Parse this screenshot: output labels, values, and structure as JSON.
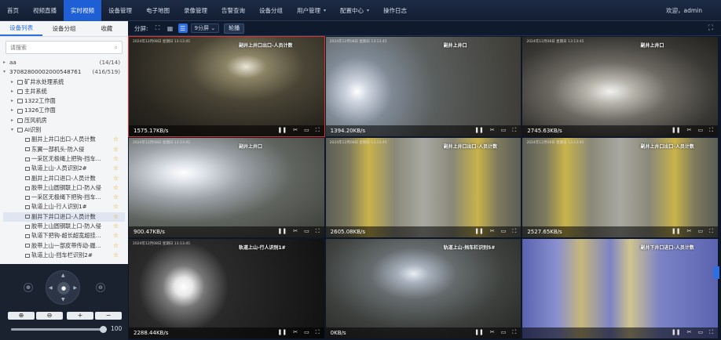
{
  "nav": {
    "items": [
      {
        "label": "首页"
      },
      {
        "label": "视频直播"
      },
      {
        "label": "实时视频",
        "active": true
      },
      {
        "label": "设备管理"
      },
      {
        "label": "电子地图"
      },
      {
        "label": "录像管理"
      },
      {
        "label": "告警查询"
      },
      {
        "label": "设备分组"
      },
      {
        "label": "用户管理",
        "dropdown": true
      },
      {
        "label": "配置中心",
        "dropdown": true
      },
      {
        "label": "操作日志"
      }
    ],
    "welcome": "欢迎，admin",
    "accent": "#1f5fd6"
  },
  "sidebar": {
    "tabs": [
      {
        "label": "设备列表",
        "active": true
      },
      {
        "label": "设备分组"
      },
      {
        "label": "收藏"
      }
    ],
    "search_placeholder": "请搜索",
    "tree": [
      {
        "label": "aa",
        "count": "(14/14)",
        "level": 0,
        "type": "arrow"
      },
      {
        "label": "37082800002000548761",
        "count": "(416/519)",
        "level": 0,
        "type": "arrow-open"
      },
      {
        "label": "矿井水处理系统",
        "level": 1,
        "type": "folder"
      },
      {
        "label": "主井系统",
        "level": 1,
        "type": "folder"
      },
      {
        "label": "1322工作面",
        "level": 1,
        "type": "folder"
      },
      {
        "label": "1326工作面",
        "level": 1,
        "type": "folder"
      },
      {
        "label": "压风机房",
        "level": 1,
        "type": "folder"
      },
      {
        "label": "AI识别",
        "level": 1,
        "type": "folder-open"
      },
      {
        "label": "副井上井口出口-人员计数",
        "level": 2,
        "type": "cam",
        "star": true
      },
      {
        "label": "东翼一部机头-防入侵",
        "level": 2,
        "type": "cam",
        "star": true
      },
      {
        "label": "一采区无极绳上把钩-挡车...",
        "level": 2,
        "type": "cam",
        "star": true
      },
      {
        "label": "轨道上山-人员识别2#",
        "level": 2,
        "type": "cam",
        "star": true
      },
      {
        "label": "副井上井口进口-人员计数",
        "level": 2,
        "type": "cam",
        "star": true
      },
      {
        "label": "胶带上山圆钢联上口-防入侵",
        "level": 2,
        "type": "cam",
        "star": true
      },
      {
        "label": "一采区无极绳下把钩-挡车...",
        "level": 2,
        "type": "cam",
        "star": true
      },
      {
        "label": "轨道上山-行人识别1#",
        "level": 2,
        "type": "cam",
        "star": true
      },
      {
        "label": "副井下井口进口-人员计数",
        "level": 2,
        "type": "cam",
        "star": true,
        "selected": true
      },
      {
        "label": "胶带上山圆钢联上口-防入侵",
        "level": 2,
        "type": "cam",
        "star": true
      },
      {
        "label": "轨道下把钩-超长超宽超挂...",
        "level": 2,
        "type": "cam",
        "star": true
      },
      {
        "label": "胶带上山一部皮带传动-履...",
        "level": 2,
        "type": "cam",
        "star": true
      },
      {
        "label": "轨道上山-挡车栏识别2#",
        "level": 2,
        "type": "cam",
        "star": true
      }
    ],
    "star_color": "#e8a317"
  },
  "ptz": {
    "zoom_in_icon": "zoom-in-icon",
    "zoom_out_icon": "zoom-out-icon",
    "focus_near": "⊕",
    "focus_far": "⊖",
    "plus": "+",
    "minus": "−",
    "speed_value": "100",
    "speed_fraction": 1.0
  },
  "toolbar": {
    "split_label": "分屏:",
    "split_select": "9分屏",
    "carousel_button": "轮播"
  },
  "cells": [
    {
      "ts": "2024年12月08日 星期日 13:13:45",
      "title": "副井上井口出口-人员计数",
      "rate": "1575.17KB/s",
      "selected": true,
      "tone": "dark"
    },
    {
      "ts": "2024年12月08日 星期日 13:13:45",
      "title": "副井上井口",
      "rate": "1394.20KB/s",
      "tone": "tunnel"
    },
    {
      "ts": "2024年12月08日 星期日 13:13:45",
      "title": "副井上井口",
      "rate": "2745.63KB/s",
      "tone": "arch"
    },
    {
      "ts": "2024年12月08日 星期日 13:13:45",
      "title": "副井上井口",
      "rate": "900.47KB/s",
      "tone": "tunnel2"
    },
    {
      "ts": "2024年12月08日 星期日 13:13:45",
      "title": "副井上井口出口-人员计数",
      "rate": "2605.08KB/s",
      "tone": "shaft"
    },
    {
      "ts": "2024年12月08日 星期日 13:13:45",
      "title": "副井上井口出口-人员计数",
      "rate": "2527.65KB/s",
      "tone": "shaft"
    },
    {
      "ts": "2024年12月08日 星期日 13:13:45",
      "title": "轨道上山-行人识别1#",
      "rate": "2288.44KB/s",
      "tone": "lights"
    },
    {
      "ts": "",
      "title": "轨道上山-挡车栏识别5#",
      "rate": "0KB/s",
      "tone": "rail"
    },
    {
      "ts": "",
      "title": "副井下井口进口-人员计数",
      "rate": "",
      "tone": "blue"
    }
  ],
  "cell_controls": [
    "❚❚",
    "✂",
    "▭",
    "⛶"
  ]
}
